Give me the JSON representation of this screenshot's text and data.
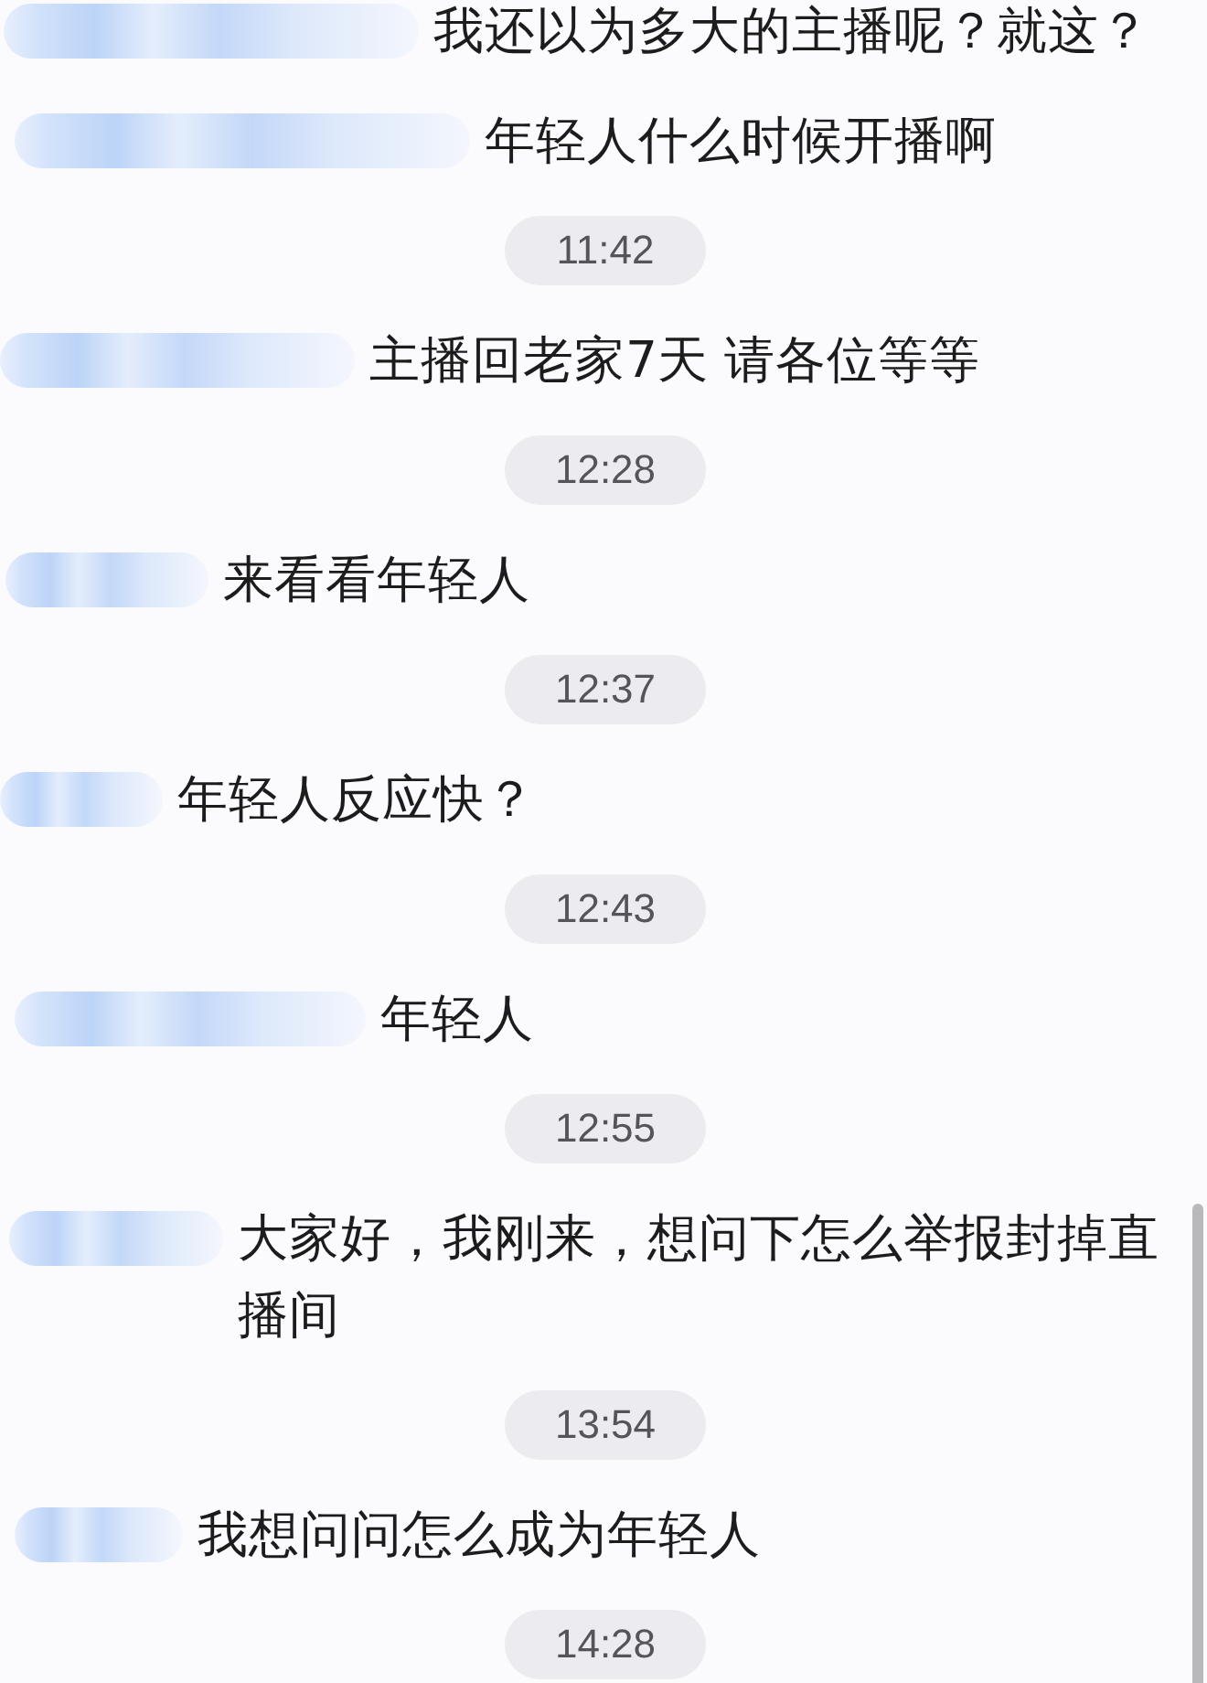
{
  "chat": {
    "items": [
      {
        "kind": "message",
        "text": "我还以为多大的主播呢？就这？"
      },
      {
        "kind": "message",
        "text": "年轻人什么时候开播啊"
      },
      {
        "kind": "time",
        "text": "11:42"
      },
      {
        "kind": "message",
        "text": "主播回老家7天 请各位等等"
      },
      {
        "kind": "time",
        "text": "12:28"
      },
      {
        "kind": "message",
        "text": "来看看年轻人"
      },
      {
        "kind": "time",
        "text": "12:37"
      },
      {
        "kind": "message",
        "text": "年轻人反应快？"
      },
      {
        "kind": "time",
        "text": "12:43"
      },
      {
        "kind": "message",
        "text": "年轻人"
      },
      {
        "kind": "time",
        "text": "12:55"
      },
      {
        "kind": "message",
        "text": "大家好，我刚来，想问下怎么举报封掉直播间"
      },
      {
        "kind": "time",
        "text": "13:54"
      },
      {
        "kind": "message",
        "text": "我想问问怎么成为年轻人"
      },
      {
        "kind": "time",
        "text": "14:28"
      }
    ]
  }
}
